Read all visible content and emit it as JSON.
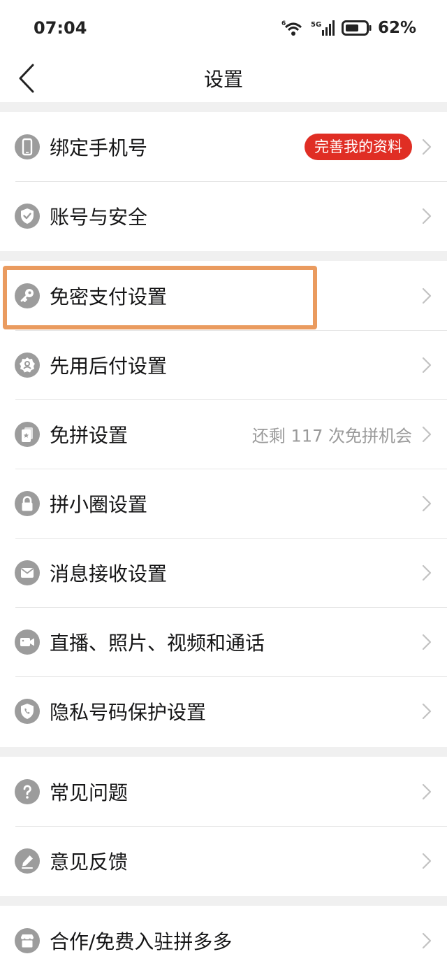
{
  "status_bar": {
    "time": "07:04",
    "network": "5G",
    "battery": "62%"
  },
  "navbar": {
    "title": "设置",
    "back_icon": "chevron-left-icon"
  },
  "groups": [
    {
      "items": [
        {
          "label": "绑定手机号",
          "icon": "phone-icon",
          "badge": "完善我的资料"
        },
        {
          "label": "账号与安全",
          "icon": "shield-check-icon"
        }
      ]
    },
    {
      "items": [
        {
          "label": "免密支付设置",
          "icon": "key-icon",
          "highlighted": true
        },
        {
          "label": "先用后付设置",
          "icon": "badge-person-icon"
        },
        {
          "label": "免拼设置",
          "icon": "cards-icon",
          "extra": "还剩 117 次免拼机会"
        },
        {
          "label": "拼小圈设置",
          "icon": "lock-icon"
        },
        {
          "label": "消息接收设置",
          "icon": "mail-icon"
        },
        {
          "label": "直播、照片、视频和通话",
          "icon": "video-camera-icon"
        },
        {
          "label": "隐私号码保护设置",
          "icon": "shield-phone-icon"
        }
      ]
    },
    {
      "items": [
        {
          "label": "常见问题",
          "icon": "question-icon"
        },
        {
          "label": "意见反馈",
          "icon": "pencil-icon"
        }
      ]
    },
    {
      "items": [
        {
          "label": "合作/免费入驻拼多多",
          "icon": "store-icon"
        }
      ]
    }
  ],
  "colors": {
    "accent": "#e02e24",
    "icon_gray": "#9c9c9c",
    "highlight_border": "#ea9b5f",
    "separator": "#f0f0f0"
  }
}
